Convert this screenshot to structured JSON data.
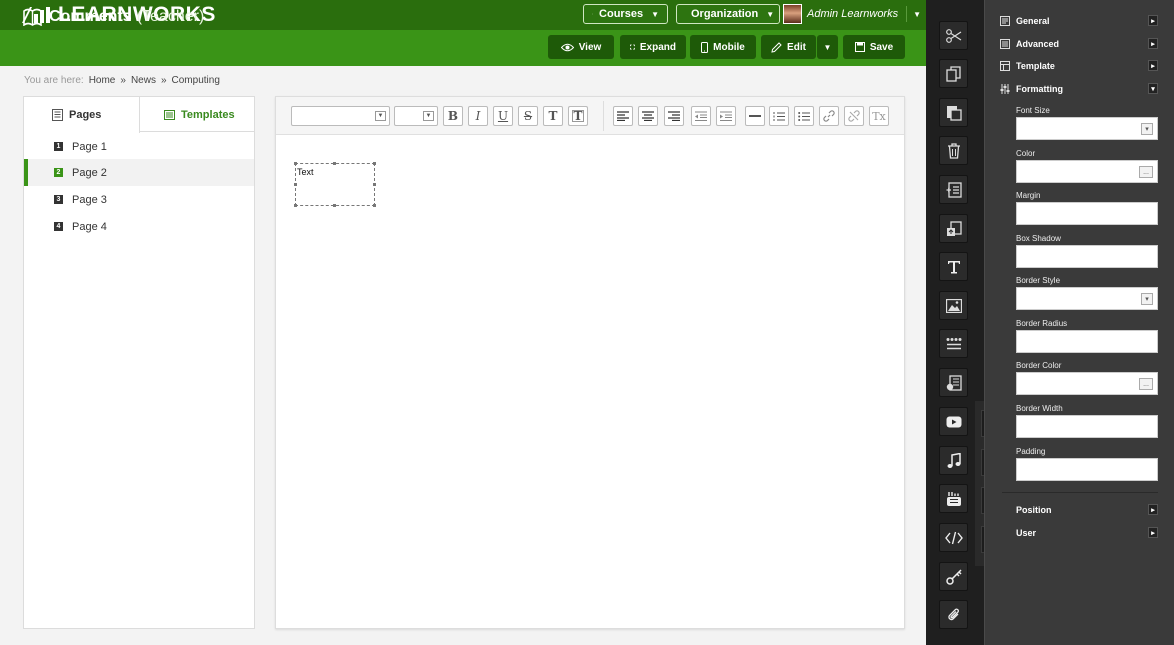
{
  "header": {
    "logo": "LEARNWORKS",
    "nav": [
      {
        "label": "Courses"
      },
      {
        "label": "Organization"
      }
    ],
    "user_name": "Admin Learnworks"
  },
  "titlebar": {
    "title": "Comments",
    "role": "(Teacher)",
    "actions": {
      "view": "View",
      "expand": "Expand",
      "mobile": "Mobile",
      "edit": "Edit",
      "save": "Save"
    }
  },
  "breadcrumb": {
    "prefix": "You are here:",
    "items": [
      "Home",
      "News",
      "Computing"
    ],
    "separator": "»"
  },
  "leftpanel": {
    "tabs": {
      "pages": "Pages",
      "templates": "Templates"
    },
    "pages": [
      {
        "num": "1",
        "label": "Page 1"
      },
      {
        "num": "2",
        "label": "Page 2"
      },
      {
        "num": "3",
        "label": "Page 3"
      },
      {
        "num": "4",
        "label": "Page 4"
      }
    ],
    "selected_page": "Page 2"
  },
  "editor": {
    "toolbar": {
      "bold": "B",
      "italic": "I",
      "underline": "U",
      "strike": "S",
      "text": "T",
      "text_box": "T",
      "clear_format": "Tx"
    },
    "textbox_text": "Text"
  },
  "rightpanel": {
    "sections_top": {
      "general": "General",
      "advanced": "Advanced",
      "template": "Template",
      "formatting": "Formatting"
    },
    "fields": {
      "font_size": "Font Size",
      "color": "Color",
      "margin": "Margin",
      "box_shadow": "Box Shadow",
      "border_style": "Border Style",
      "border_radius": "Border Radius",
      "border_color": "Border Color",
      "border_width": "Border Width",
      "padding": "Padding"
    },
    "color_button": "...",
    "sections_bottom": {
      "position": "Position",
      "user": "User"
    }
  },
  "colors": {
    "header_dark": "#2a6e0d",
    "header_green": "#3a9417",
    "button_dark": "#1e5a08",
    "sidebar_dark": "#1f1f1f",
    "panel_grey": "#3a3a3a"
  }
}
